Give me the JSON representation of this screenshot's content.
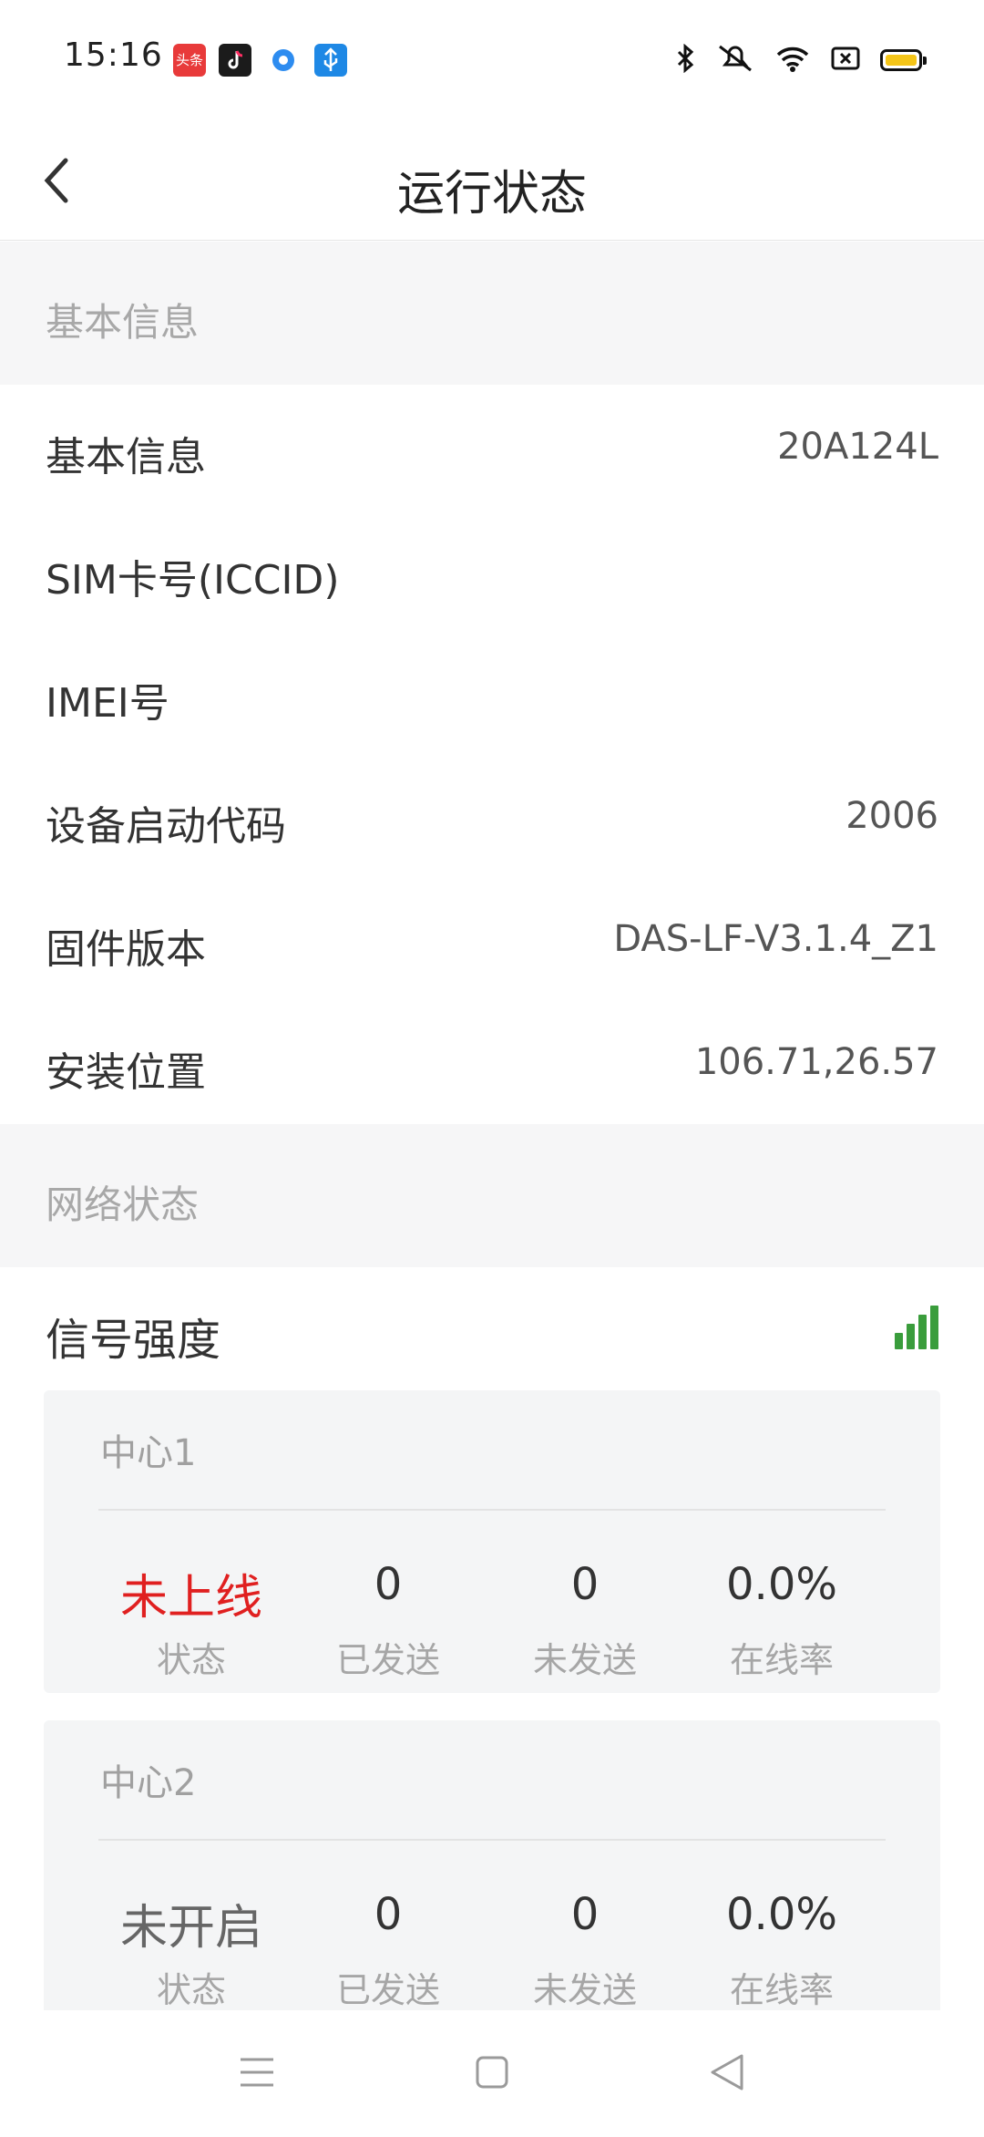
{
  "status_bar": {
    "time": "15:16",
    "apps": [
      {
        "icon": "toutiao-app-icon",
        "label": "头条",
        "color": "#e83a3a"
      },
      {
        "icon": "tiktok-app-icon",
        "color": "#1b1b1b"
      },
      {
        "icon": "browser-app-icon",
        "color": "#2d8cf0"
      },
      {
        "icon": "usb-debug-icon",
        "color": "#1e88e5"
      }
    ],
    "right_icons": [
      "bluetooth-icon",
      "mute-icon",
      "wifi-icon",
      "nfc-icon",
      "battery-icon"
    ],
    "battery_color": "#f5c518"
  },
  "header": {
    "back_icon": "chevron-left-icon",
    "title": "运行状态"
  },
  "basic_section": {
    "header": "基本信息",
    "rows": [
      {
        "label": "基本信息",
        "value": "20A124L"
      },
      {
        "label": "SIM卡号(ICCID)",
        "value": ""
      },
      {
        "label": "IMEI号",
        "value": ""
      },
      {
        "label": "设备启动代码",
        "value": "2006"
      },
      {
        "label": "固件版本",
        "value": "DAS-LF-V3.1.4_Z1"
      },
      {
        "label": "安装位置",
        "value": "106.71,26.57"
      }
    ]
  },
  "network_section": {
    "header": "网络状态",
    "signal_label": "信号强度",
    "signal_icon": "signal-bars-icon",
    "signal_color": "#3a9d3c",
    "signal_level": 4,
    "signal_max": 4
  },
  "centers": [
    {
      "title": "中心1",
      "status_value": "未上线",
      "status_label": "状态",
      "sent_value": "0",
      "sent_label": "已发送",
      "unsent_value": "0",
      "unsent_label": "未发送",
      "rate_value": "0.0%",
      "rate_label": "在线率",
      "status_color": "#e02020"
    },
    {
      "title": "中心2",
      "status_value": "未开启",
      "status_label": "状态",
      "sent_value": "0",
      "sent_label": "已发送",
      "unsent_value": "0",
      "unsent_label": "未发送",
      "rate_value": "0.0%",
      "rate_label": "在线率",
      "status_color": "#666666"
    }
  ],
  "nav_bar": {
    "buttons": [
      "menu-icon",
      "home-icon",
      "back-triangle-icon"
    ]
  }
}
